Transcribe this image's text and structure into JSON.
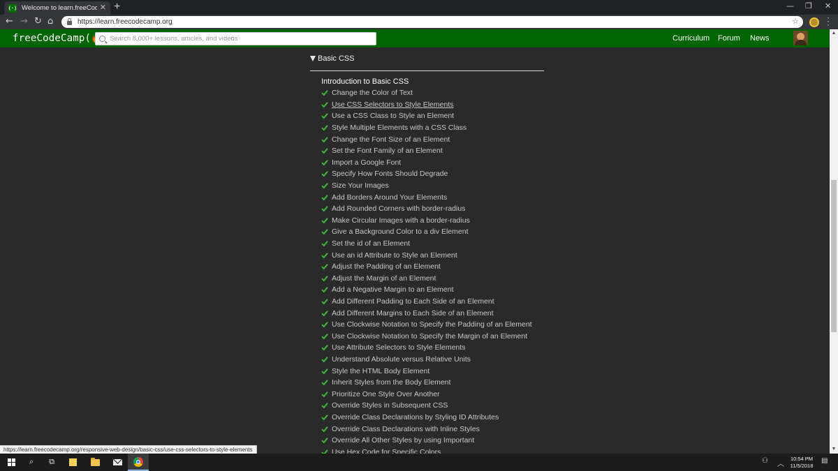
{
  "browser": {
    "tab": {
      "title": "Welcome to learn.freeCodeCamp",
      "favicon_text": "(·)",
      "close_glyph": "✕"
    },
    "new_tab_glyph": "+",
    "window_controls": [
      "—",
      "❐",
      "✕"
    ],
    "nav": {
      "back": "←",
      "forward": "→",
      "reload": "↻",
      "home": "⌂"
    },
    "url": "https://learn.freecodecamp.org",
    "bookmark_glyph": "☆"
  },
  "site": {
    "logo": "freeCodeCamp(🔥)",
    "search_placeholder": "Search 8,000+ lessons, articles, and videos",
    "nav_links": [
      "Curriculum",
      "Forum",
      "News"
    ]
  },
  "block": {
    "title": "Basic CSS",
    "superblock": "Introduction to Basic CSS",
    "check_color": "#3cb63c",
    "lessons": [
      {
        "label": "Change the Color of Text"
      },
      {
        "label": "Use CSS Selectors to Style Elements",
        "hovered": true
      },
      {
        "label": "Use a CSS Class to Style an Element"
      },
      {
        "label": "Style Multiple Elements with a CSS Class"
      },
      {
        "label": "Change the Font Size of an Element"
      },
      {
        "label": "Set the Font Family of an Element"
      },
      {
        "label": "Import a Google Font"
      },
      {
        "label": "Specify How Fonts Should Degrade"
      },
      {
        "label": "Size Your Images"
      },
      {
        "label": "Add Borders Around Your Elements"
      },
      {
        "label": "Add Rounded Corners with border-radius"
      },
      {
        "label": "Make Circular Images with a border-radius"
      },
      {
        "label": "Give a Background Color to a div Element"
      },
      {
        "label": "Set the id of an Element"
      },
      {
        "label": "Use an id Attribute to Style an Element"
      },
      {
        "label": "Adjust the Padding of an Element"
      },
      {
        "label": "Adjust the Margin of an Element"
      },
      {
        "label": "Add a Negative Margin to an Element"
      },
      {
        "label": "Add Different Padding to Each Side of an Element"
      },
      {
        "label": "Add Different Margins to Each Side of an Element"
      },
      {
        "label": "Use Clockwise Notation to Specify the Padding of an Element"
      },
      {
        "label": "Use Clockwise Notation to Specify the Margin of an Element"
      },
      {
        "label": "Use Attribute Selectors to Style Elements"
      },
      {
        "label": "Understand Absolute versus Relative Units"
      },
      {
        "label": "Style the HTML Body Element"
      },
      {
        "label": "Inherit Styles from the Body Element"
      },
      {
        "label": "Prioritize One Style Over Another"
      },
      {
        "label": "Override Styles in Subsequent CSS"
      },
      {
        "label": "Override Class Declarations by Styling ID Attributes"
      },
      {
        "label": "Override Class Declarations with Inline Styles"
      },
      {
        "label": "Override All Other Styles by using Important"
      },
      {
        "label": "Use Hex Code for Specific Colors"
      }
    ]
  },
  "status_url": "https://learn.freecodecamp.org/responsive-web-design/basic-css/use-css-selectors-to-style-elements",
  "taskbar": {
    "search_glyph": "⌕",
    "taskview_glyph": "⧉",
    "tray": {
      "people": "⚇",
      "chevron": "︿",
      "notifications": "▤"
    },
    "time": "10:54 PM",
    "date": "11/5/2018"
  }
}
